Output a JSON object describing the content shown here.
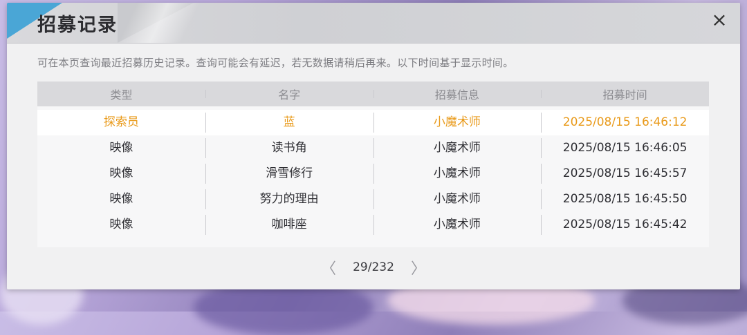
{
  "header": {
    "title": "招募记录",
    "close_icon": "×"
  },
  "notice": "可在本页查询最近招募历史记录。查询可能会有延迟，若无数据请稍后再来。以下时间基于显示时间。",
  "table": {
    "columns": [
      "类型",
      "名字",
      "招募信息",
      "招募时间"
    ],
    "rows": [
      {
        "type": "探索员",
        "name": "蓝",
        "info": "小魔术师",
        "time": "2025/08/15 16:46:12",
        "highlight": true
      },
      {
        "type": "映像",
        "name": "读书角",
        "info": "小魔术师",
        "time": "2025/08/15 16:46:05",
        "highlight": false
      },
      {
        "type": "映像",
        "name": "滑雪修行",
        "info": "小魔术师",
        "time": "2025/08/15 16:45:57",
        "highlight": false
      },
      {
        "type": "映像",
        "name": "努力的理由",
        "info": "小魔术师",
        "time": "2025/08/15 16:45:50",
        "highlight": false
      },
      {
        "type": "映像",
        "name": "咖啡座",
        "info": "小魔术师",
        "time": "2025/08/15 16:45:42",
        "highlight": false
      }
    ]
  },
  "pager": {
    "prev_icon": "〈",
    "next_icon": "〉",
    "current": "29/232"
  },
  "colors": {
    "highlight": "#e99a1a",
    "accent": "#4aa6d6"
  }
}
